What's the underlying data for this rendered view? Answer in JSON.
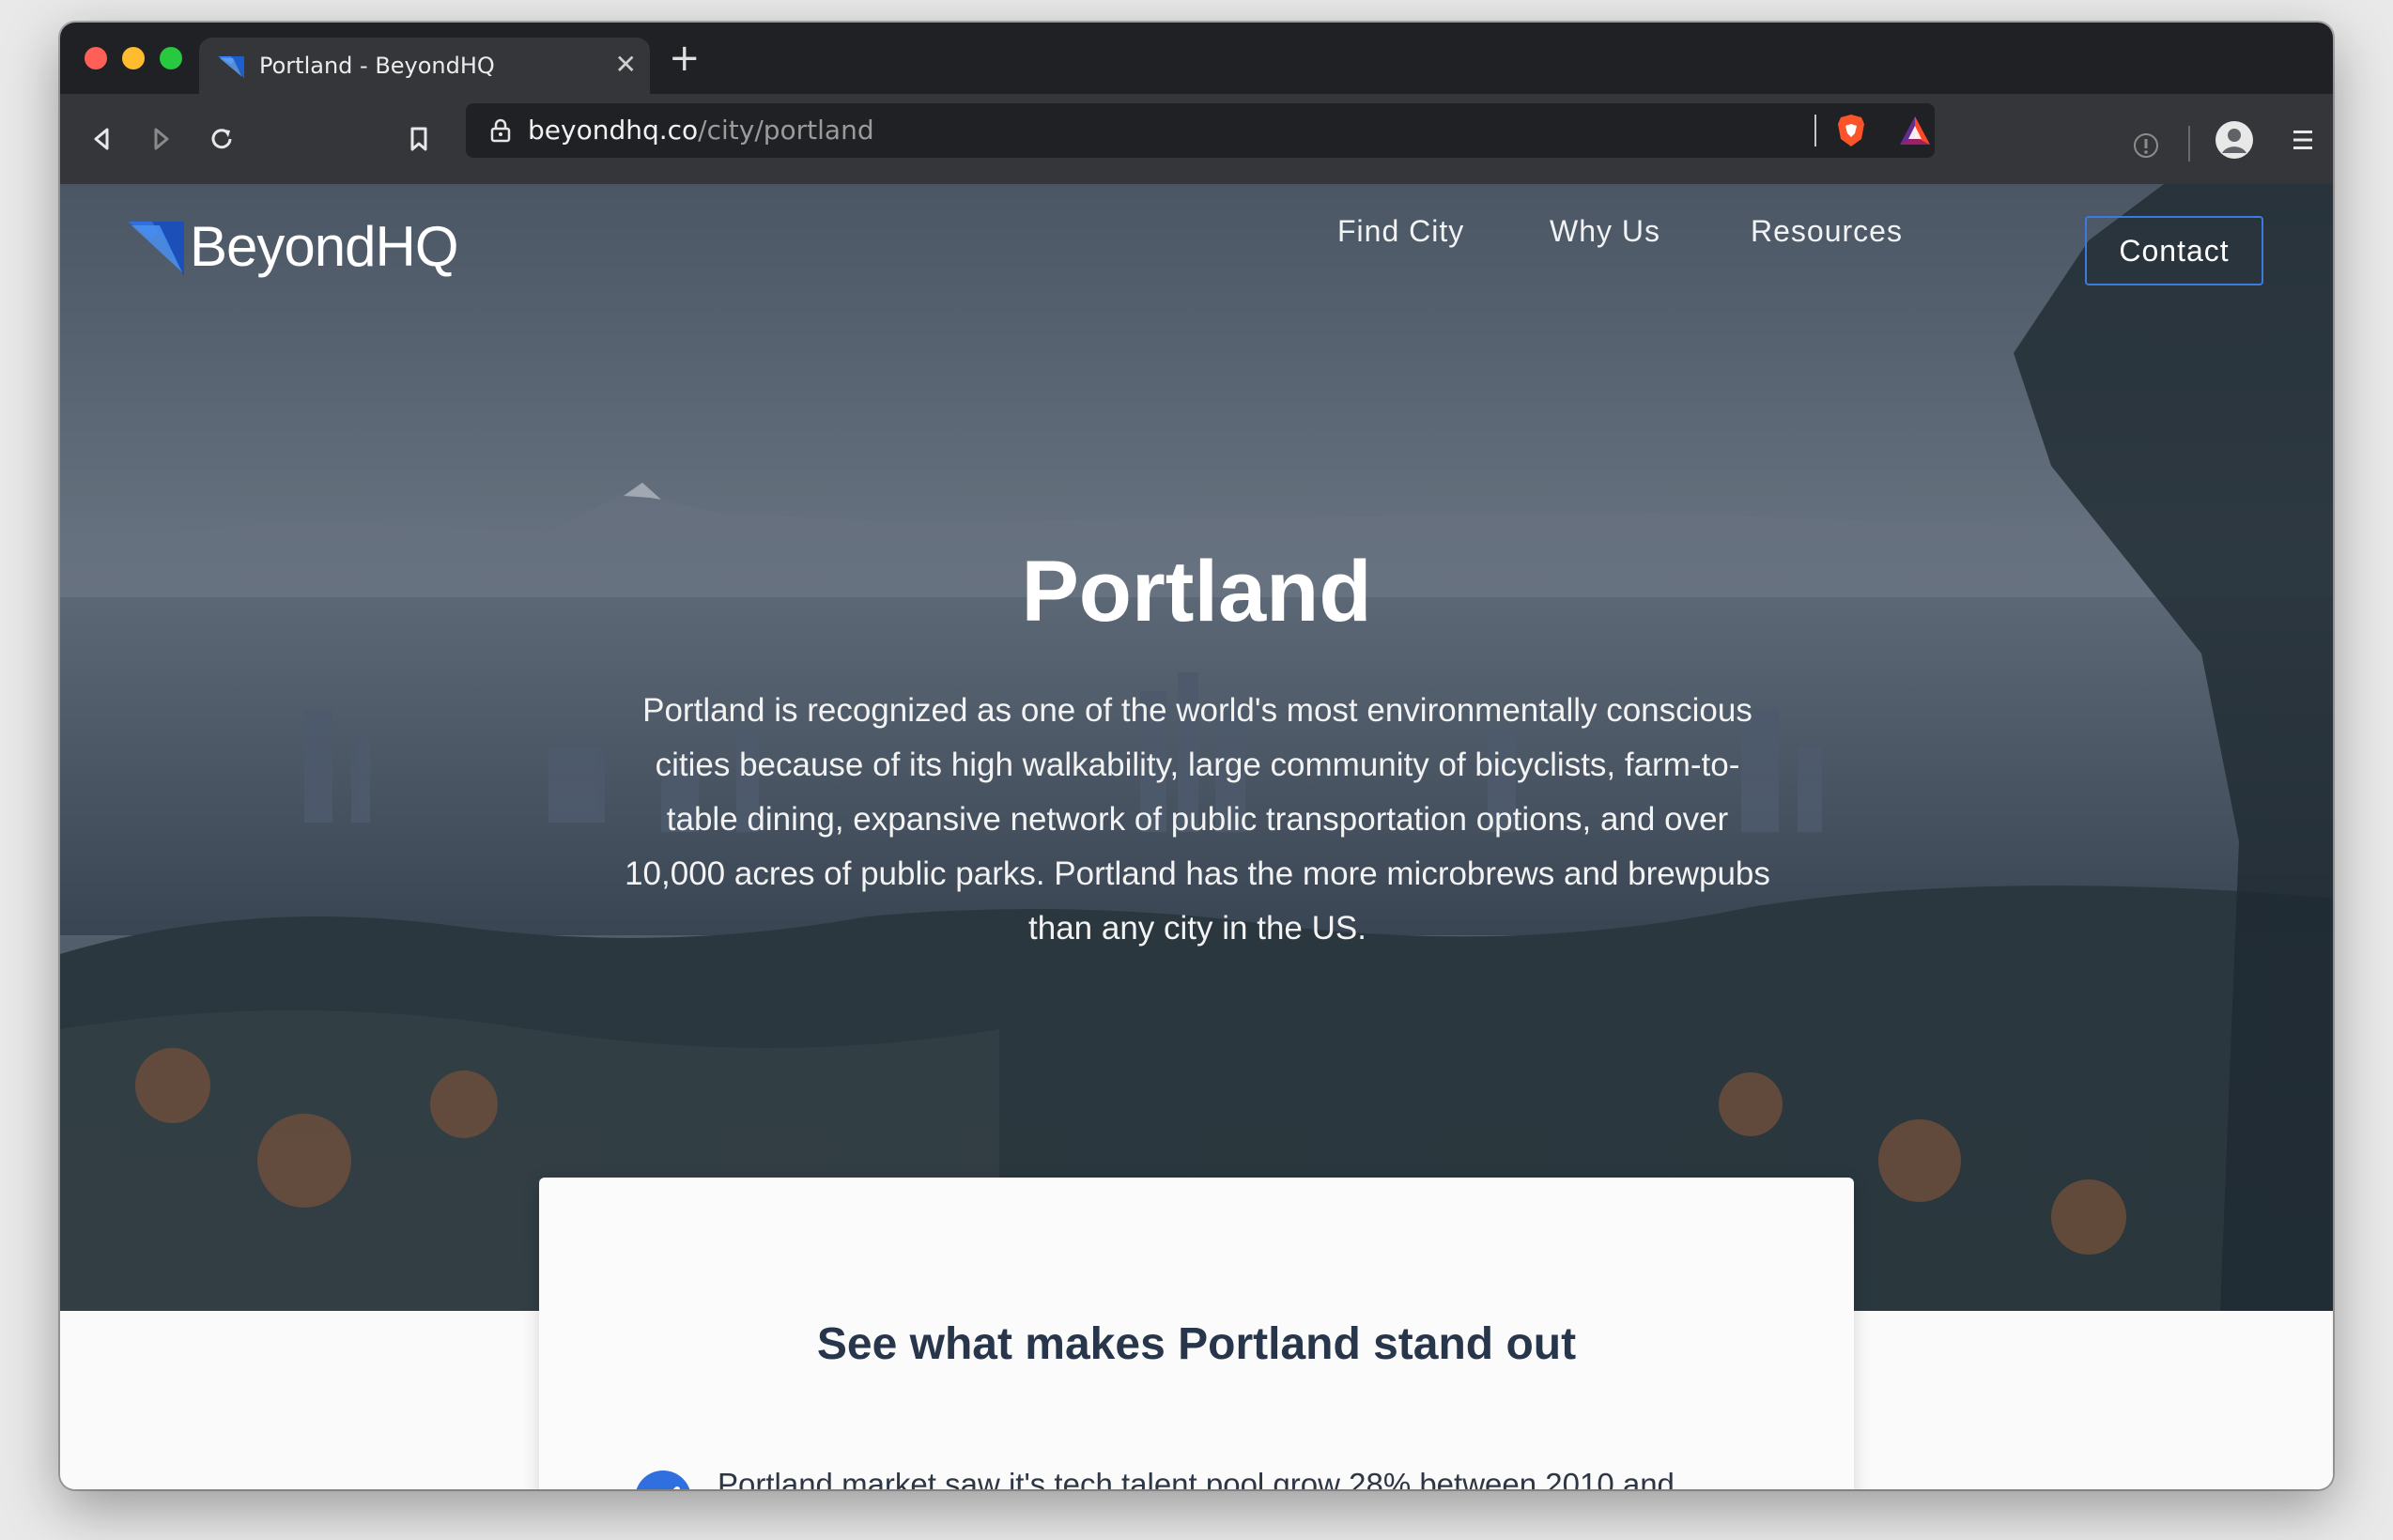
{
  "browser": {
    "tab_title": "Portland - BeyondHQ",
    "url_host": "beyondhq.co",
    "url_path": "/city/portland"
  },
  "site": {
    "logo_text": "BeyondHQ",
    "nav": [
      "Find City",
      "Why Us",
      "Resources"
    ],
    "contact_label": "Contact",
    "accent_color": "#3d7ae0"
  },
  "hero": {
    "title": "Portland",
    "description": "Portland is recognized as one of the world's most environmentally conscious cities because of its high walkability, large community of bicyclists, farm-to-table dining, expansive network of public transportation options, and over 10,000 acres of public parks. Portland has the more microbrews and brewpubs than any city in the US."
  },
  "highlights": {
    "heading": "See what makes Portland stand out",
    "points": [
      "Portland market saw it's tech talent pool grow 28% between 2010 and"
    ]
  }
}
